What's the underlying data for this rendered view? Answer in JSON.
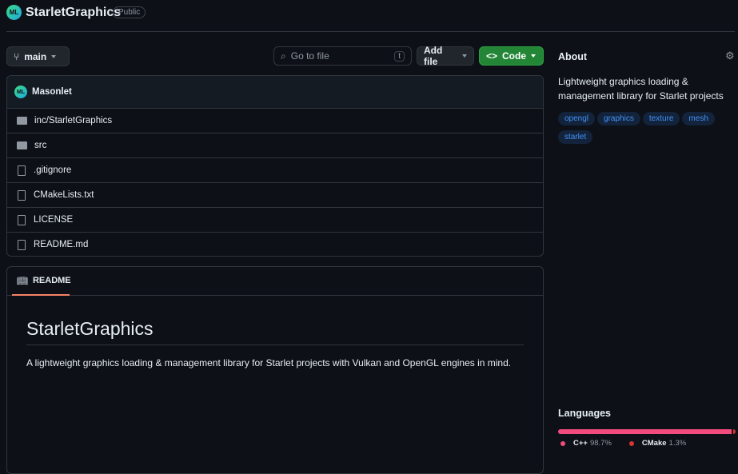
{
  "repo": {
    "owner_initials": "ML",
    "name": "StarletGraphics",
    "visibility": "Public"
  },
  "toolbar": {
    "branch": "main",
    "search_placeholder": "Go to file",
    "search_key": "t",
    "add_file": "Add file",
    "code": "Code"
  },
  "commit": {
    "author_initials": "ML",
    "author": "Masonlet"
  },
  "files": [
    {
      "name": "inc/StarletGraphics",
      "type": "folder"
    },
    {
      "name": "src",
      "type": "folder"
    },
    {
      "name": ".gitignore",
      "type": "file"
    },
    {
      "name": "CMakeLists.txt",
      "type": "file"
    },
    {
      "name": "LICENSE",
      "type": "file"
    },
    {
      "name": "README.md",
      "type": "file"
    }
  ],
  "readme": {
    "tab": "README",
    "title": "StarletGraphics",
    "body": "A lightweight graphics loading & management library for Starlet projects with Vulkan and OpenGL engines in mind."
  },
  "about": {
    "heading": "About",
    "description": "Lightweight graphics loading & management library for Starlet projects",
    "topics": [
      "opengl",
      "graphics",
      "texture",
      "mesh",
      "starlet"
    ]
  },
  "languages": {
    "heading": "Languages",
    "items": [
      {
        "name": "C++",
        "percent": "98.7%",
        "value": 98.7,
        "color": "#f34b7d"
      },
      {
        "name": "CMake",
        "percent": "1.3%",
        "value": 1.3,
        "color": "#DA3434"
      }
    ]
  }
}
